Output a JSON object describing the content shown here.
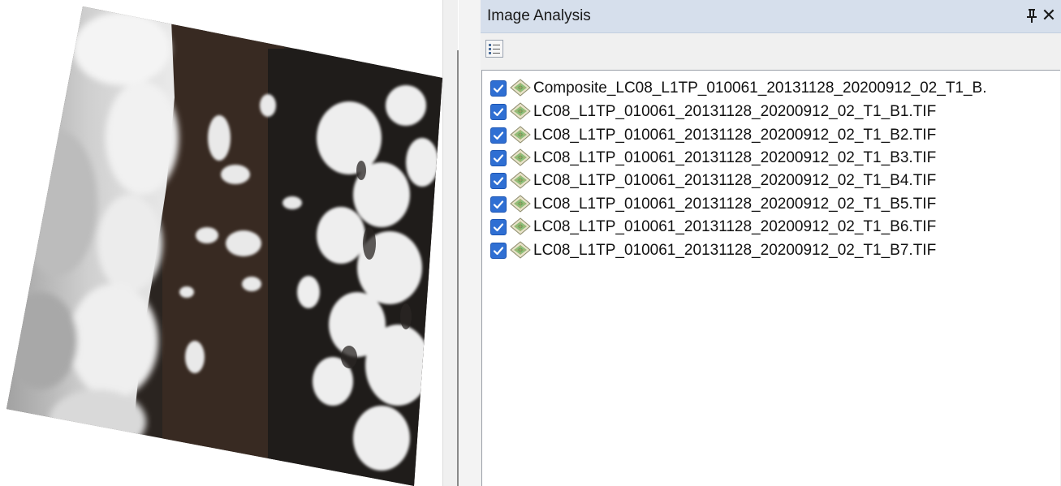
{
  "panel": {
    "title": "Image Analysis"
  },
  "layers": [
    {
      "name": "Composite_LC08_L1TP_010061_20131128_20200912_02_T1_B.",
      "checked": true
    },
    {
      "name": "LC08_L1TP_010061_20131128_20200912_02_T1_B1.TIF",
      "checked": true
    },
    {
      "name": "LC08_L1TP_010061_20131128_20200912_02_T1_B2.TIF",
      "checked": true
    },
    {
      "name": "LC08_L1TP_010061_20131128_20200912_02_T1_B3.TIF",
      "checked": true
    },
    {
      "name": "LC08_L1TP_010061_20131128_20200912_02_T1_B4.TIF",
      "checked": true
    },
    {
      "name": "LC08_L1TP_010061_20131128_20200912_02_T1_B5.TIF",
      "checked": true
    },
    {
      "name": "LC08_L1TP_010061_20131128_20200912_02_T1_B6.TIF",
      "checked": true
    },
    {
      "name": "LC08_L1TP_010061_20131128_20200912_02_T1_B7.TIF",
      "checked": true
    }
  ],
  "icons": {
    "pin": "pin-icon",
    "close": "close-icon",
    "options": "list-options-icon",
    "layer": "raster-layer-icon",
    "check": "checkbox-checked-icon"
  },
  "colors": {
    "title_bar": "#d6dfec",
    "checkbox": "#2f6fd3"
  }
}
